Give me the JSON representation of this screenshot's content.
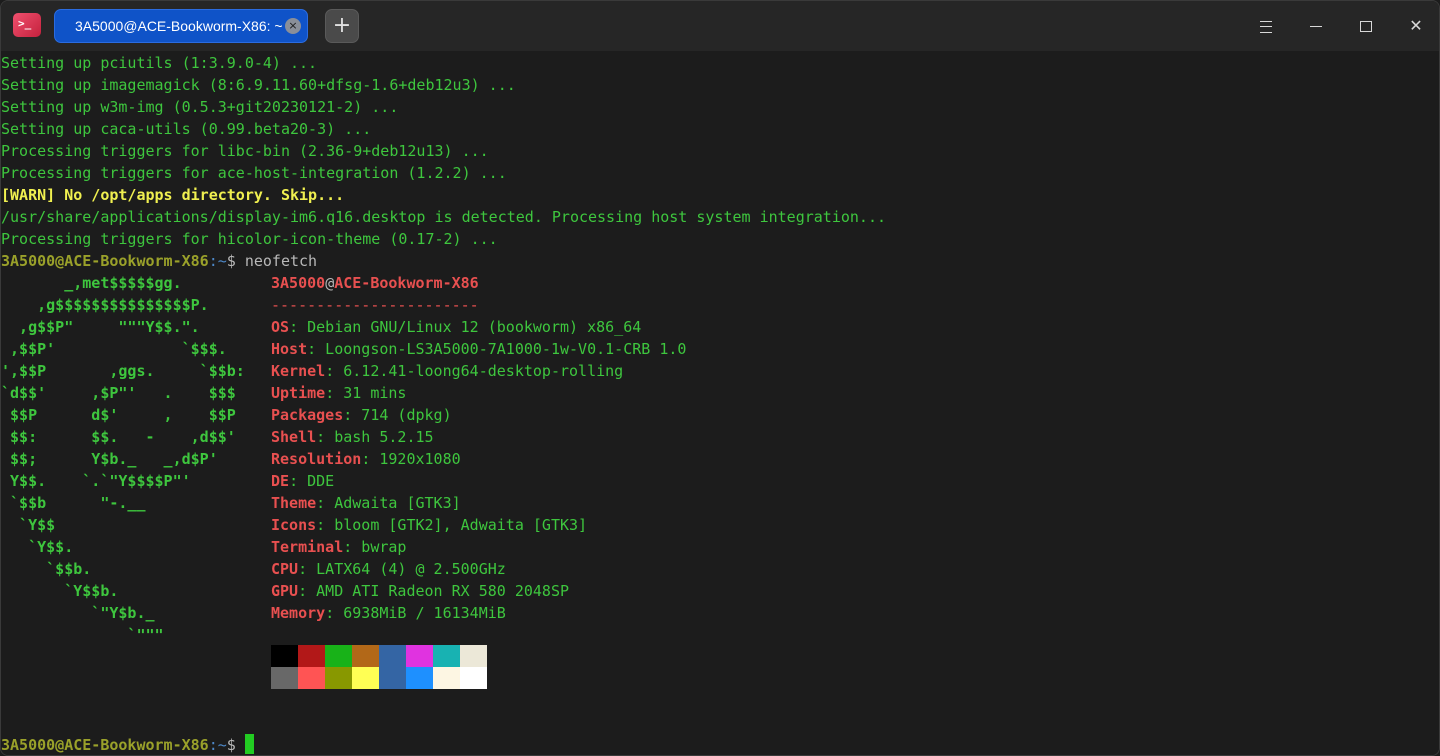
{
  "titlebar": {
    "app_icon_glyph": ">_",
    "tab_title": "3A5000@ACE-Bookworm-X86: ~",
    "tab_close_glyph": "×",
    "new_tab_glyph": "+"
  },
  "output_lines": [
    "Setting up pciutils (1:3.9.0-4) ...",
    "Setting up imagemagick (8:6.9.11.60+dfsg-1.6+deb12u3) ...",
    "Setting up w3m-img (0.5.3+git20230121-2) ...",
    "Setting up caca-utils (0.99.beta20-3) ...",
    "Processing triggers for libc-bin (2.36-9+deb12u13) ...",
    "Processing triggers for ace-host-integration (1.2.2) ..."
  ],
  "warn_line": "[WARN] No /opt/apps directory. Skip...",
  "output_lines_2": [
    "/usr/share/applications/display-im6.q16.desktop is detected. Processing host system integration...",
    "Processing triggers for hicolor-icon-theme (0.17-2) ..."
  ],
  "prompt": {
    "user_host": "3A5000@ACE-Bookworm-X86",
    "path": ":~",
    "sign": "$",
    "command": " neofetch"
  },
  "logo_lines": [
    "       _,met$$$$$gg.",
    "    ,g$$$$$$$$$$$$$$$P.",
    "  ,g$$P\"     \"\"\"Y$$.\".",
    " ,$$P'              `$$$.",
    "',$$P       ,ggs.     `$$b:",
    "`d$$'     ,$P\"'   .    $$$",
    " $$P      d$'     ,    $$P",
    " $$:      $$.   -    ,d$$'",
    " $$;      Y$b._   _,d$P'",
    " Y$$.    `.`\"Y$$$$P\"'",
    " `$$b      \"-.__",
    "  `Y$$",
    "   `Y$$.",
    "     `$$b.",
    "       `Y$$b.",
    "          `\"Y$b._",
    "              `\"\"\""
  ],
  "neofetch": {
    "user": "3A5000",
    "at": "@",
    "host": "ACE-Bookworm-X86",
    "separator": "-----------------------",
    "items": [
      {
        "key": "OS",
        "value": ": Debian GNU/Linux 12 (bookworm) x86_64"
      },
      {
        "key": "Host",
        "value": ": Loongson-LS3A5000-7A1000-1w-V0.1-CRB 1.0"
      },
      {
        "key": "Kernel",
        "value": ": 6.12.41-loong64-desktop-rolling"
      },
      {
        "key": "Uptime",
        "value": ": 31 mins"
      },
      {
        "key": "Packages",
        "value": ": 714 (dpkg)"
      },
      {
        "key": "Shell",
        "value": ": bash 5.2.15"
      },
      {
        "key": "Resolution",
        "value": ": 1920x1080"
      },
      {
        "key": "DE",
        "value": ": DDE"
      },
      {
        "key": "Theme",
        "value": ": Adwaita [GTK3]"
      },
      {
        "key": "Icons",
        "value": ": bloom [GTK2], Adwaita [GTK3]"
      },
      {
        "key": "Terminal",
        "value": ": bwrap"
      },
      {
        "key": "CPU",
        "value": ": LATX64 (4) @ 2.500GHz"
      },
      {
        "key": "GPU",
        "value": ": AMD ATI Radeon RX 580 2048SP"
      },
      {
        "key": "Memory",
        "value": ": 6938MiB / 16134MiB"
      }
    ],
    "palette_row1": [
      "#000000",
      "#b21818",
      "#18b218",
      "#b26818",
      "#3465a4",
      "#e033e0",
      "#18b2b2",
      "#ece8d8"
    ],
    "palette_row2": [
      "#686868",
      "#ff5454",
      "#889800",
      "#ffff54",
      "#3465a4",
      "#1e90ff",
      "#fdf6e3",
      "#ffffff"
    ]
  },
  "final_prompt": {
    "user_host": "3A5000@ACE-Bookworm-X86",
    "path": ":~",
    "sign": "$ "
  }
}
